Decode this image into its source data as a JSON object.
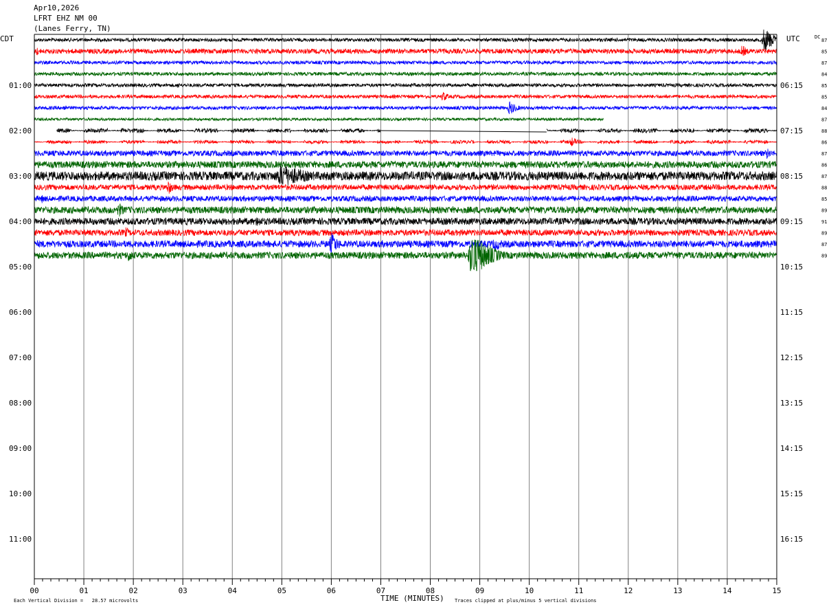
{
  "header": {
    "date": "Apr10,2026",
    "station": "LFRT EHZ NM 00",
    "location": "(Lanes Ferry, TN)"
  },
  "left_tz": "CDT",
  "right_tz": "UTC",
  "dc_label": "DC",
  "footer": {
    "xlabel": "TIME (MINUTES)",
    "scale_note": "Each Vertical Division =   28.57 microvolts",
    "clip_note": "Traces clipped at plus/minus 5 vertical divisions"
  },
  "chart_data": {
    "type": "helicorder",
    "x_range_minutes": [
      0,
      15
    ],
    "x_ticks": [
      "00",
      "01",
      "02",
      "03",
      "04",
      "05",
      "06",
      "07",
      "08",
      "09",
      "10",
      "11",
      "12",
      "13",
      "14",
      "15"
    ],
    "left_hour_labels": [
      "01:00",
      "02:00",
      "03:00",
      "04:00",
      "05:00",
      "06:00",
      "07:00",
      "08:00",
      "09:00",
      "10:00",
      "11:00"
    ],
    "right_hour_labels": [
      "06:15",
      "07:15",
      "08:15",
      "09:15",
      "10:15",
      "11:15",
      "12:15",
      "13:15",
      "14:15",
      "15:15",
      "16:15"
    ],
    "dc_offsets": [
      "87",
      "85",
      "87",
      "84",
      "85",
      "85",
      "84",
      "87",
      "88",
      "86",
      "87",
      "86",
      "87",
      "88",
      "85",
      "89",
      "91",
      "89",
      "87",
      "89"
    ],
    "trace_colors": [
      "#000000",
      "#ff0000",
      "#0000ff",
      "#006400"
    ],
    "traces": [
      {
        "row": 0,
        "color": "black",
        "amp": 2.5,
        "events": [
          {
            "min": 14.75,
            "amp": 20,
            "dur": 0.45
          }
        ]
      },
      {
        "row": 1,
        "color": "red",
        "amp": 3.5,
        "events": [
          {
            "min": 0.05,
            "amp": 7,
            "dur": 0.15
          },
          {
            "min": 14.3,
            "amp": 10,
            "dur": 0.25
          }
        ]
      },
      {
        "row": 2,
        "color": "blue",
        "amp": 2.5,
        "events": [
          {
            "min": 7.9,
            "amp": 6,
            "dur": 0.1
          }
        ]
      },
      {
        "row": 3,
        "color": "green",
        "amp": 2.5,
        "events": []
      },
      {
        "row": 4,
        "color": "black",
        "amp": 2.5,
        "events": [
          {
            "min": 2.9,
            "amp": 5,
            "dur": 0.2
          }
        ]
      },
      {
        "row": 5,
        "color": "red",
        "amp": 2.5,
        "events": [
          {
            "min": 8.25,
            "amp": 9,
            "dur": 0.25
          }
        ]
      },
      {
        "row": 6,
        "color": "blue",
        "amp": 2.5,
        "events": [
          {
            "min": 0.6,
            "amp": 7,
            "dur": 0.15
          },
          {
            "min": 9.6,
            "amp": 11,
            "dur": 0.35
          }
        ]
      },
      {
        "row": 7,
        "color": "green",
        "amp": 2.0,
        "events": [],
        "gaps": [
          [
            11.5,
            14.4
          ]
        ],
        "end": 14.4
      },
      {
        "row": 8,
        "color": "black",
        "amp": 3.0,
        "events": [],
        "start": 0.45,
        "gaps": [
          [
            7.0,
            10.35
          ]
        ],
        "flat_segments": true
      },
      {
        "row": 9,
        "color": "red",
        "amp": 2.5,
        "events": [
          {
            "min": 10.85,
            "amp": 8,
            "dur": 0.3
          }
        ],
        "flat_segments": true
      },
      {
        "row": 10,
        "color": "blue",
        "amp": 4.0,
        "events": [
          {
            "min": 14.8,
            "amp": 9,
            "dur": 0.25
          }
        ]
      },
      {
        "row": 11,
        "color": "green",
        "amp": 5.0,
        "events": []
      },
      {
        "row": 12,
        "color": "black",
        "amp": 6.5,
        "events": [
          {
            "min": 5.0,
            "amp": 18,
            "dur": 1.3
          }
        ]
      },
      {
        "row": 13,
        "color": "red",
        "amp": 4.0,
        "events": [
          {
            "min": 2.7,
            "amp": 12,
            "dur": 0.25
          }
        ]
      },
      {
        "row": 14,
        "color": "blue",
        "amp": 4.0,
        "events": [
          {
            "min": 0.15,
            "amp": 7,
            "dur": 0.25
          }
        ]
      },
      {
        "row": 15,
        "color": "green",
        "amp": 5.0,
        "events": [
          {
            "min": 1.7,
            "amp": 12,
            "dur": 0.3
          }
        ]
      },
      {
        "row": 16,
        "color": "black",
        "amp": 5.0,
        "events": [
          {
            "min": 4.5,
            "amp": 10,
            "dur": 0.3
          }
        ]
      },
      {
        "row": 17,
        "color": "red",
        "amp": 4.5,
        "events": [
          {
            "min": 1.85,
            "amp": 9,
            "dur": 0.2
          }
        ]
      },
      {
        "row": 18,
        "color": "blue",
        "amp": 5.0,
        "events": [
          {
            "min": 6.0,
            "amp": 18,
            "dur": 0.35
          },
          {
            "min": 9.3,
            "amp": 10,
            "dur": 0.6
          }
        ]
      },
      {
        "row": 19,
        "color": "green",
        "amp": 5.0,
        "events": [
          {
            "min": 1.9,
            "amp": 12,
            "dur": 0.25
          },
          {
            "min": 8.85,
            "amp": 38,
            "dur": 0.75
          },
          {
            "min": 12.0,
            "amp": 9,
            "dur": 0.2
          }
        ]
      }
    ]
  }
}
